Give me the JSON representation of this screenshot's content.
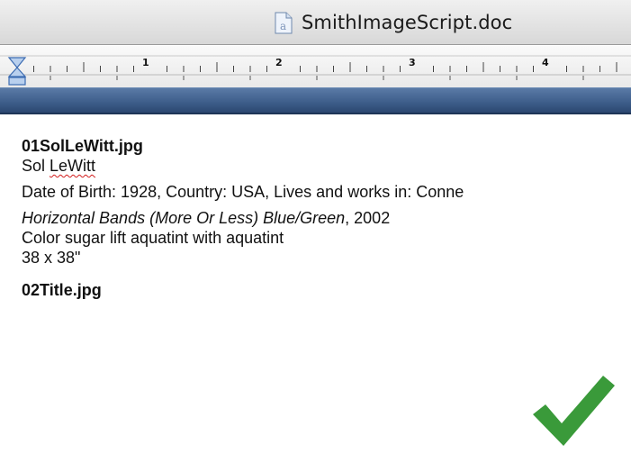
{
  "window": {
    "title": "SmithImageScript.doc",
    "doc_icon": "word-document-icon"
  },
  "ruler": {
    "numbers": [
      "1",
      "2",
      "3",
      "4"
    ]
  },
  "document": {
    "entry1": {
      "filename": "01SolLeWitt.jpg",
      "artist_first": "Sol ",
      "artist_last": "LeWitt",
      "details": "Date of Birth: 1928, Country: USA, Lives and works in: Conne",
      "work_title": "Horizontal Bands (More Or Less) Blue/Green",
      "work_year": ", 2002",
      "medium": "Color sugar lift aquatint with aquatint",
      "size": "38 x 38\""
    },
    "entry2": {
      "filename": "02Title.jpg"
    }
  },
  "overlay": {
    "icon": "checkmark-icon",
    "color": "#3a9a3a"
  }
}
